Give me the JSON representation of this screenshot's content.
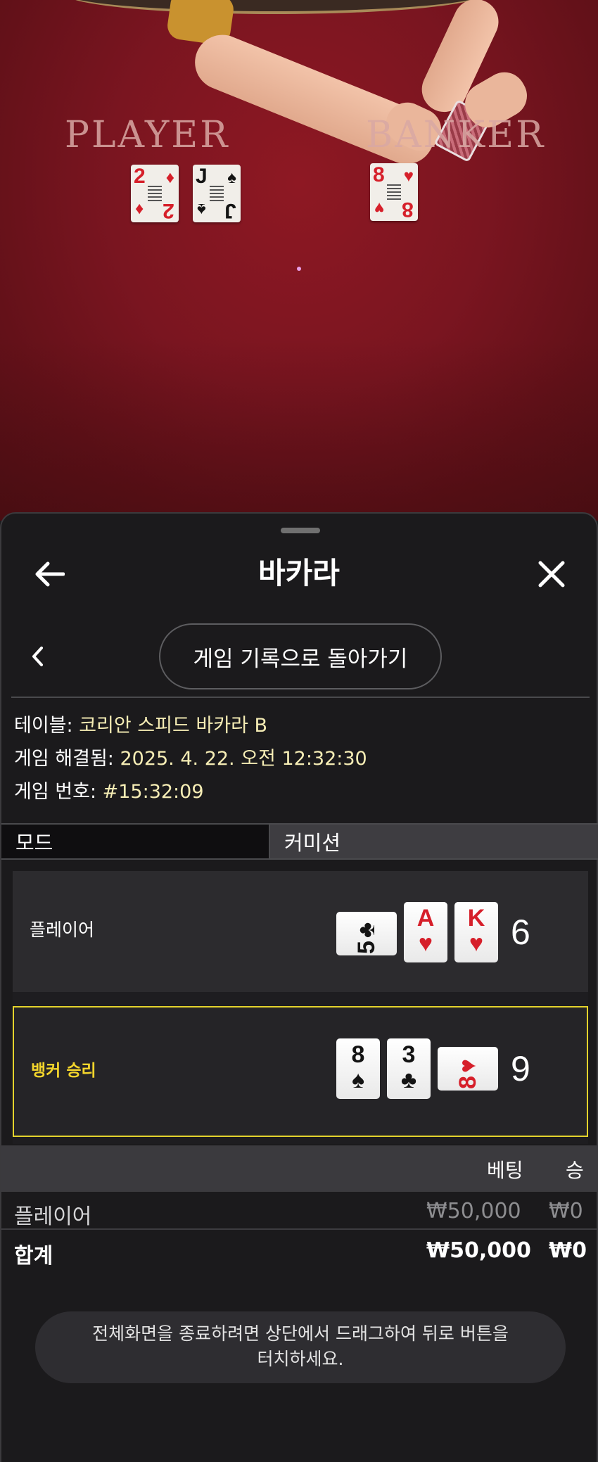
{
  "video": {
    "player_label": "PLAYER",
    "banker_label": "BANKER",
    "player_cards": [
      {
        "rank": "2",
        "suit": "♦",
        "color": "#d61f2a"
      },
      {
        "rank": "J",
        "suit": "♠",
        "color": "#141414"
      }
    ],
    "banker_cards": [
      {
        "rank": "8",
        "suit": "♥",
        "color": "#d61f2a"
      }
    ]
  },
  "header": {
    "title": "바카라",
    "back_icon": "arrow-left-icon",
    "close_icon": "close-icon"
  },
  "nav": {
    "back_chevron_icon": "chevron-left-icon",
    "history_button": "게임 기록으로 돌아가기"
  },
  "game_info": {
    "table_label": "테이블: ",
    "table_value": "코리안 스피드 바카라 B",
    "resolved_label": "게임 해결됨: ",
    "resolved_value": "2025. 4. 22. 오전 12:32:30",
    "number_label": "게임 번호: ",
    "number_value": "#15:32:09"
  },
  "tabs": {
    "mode": "모드",
    "commission": "커미션"
  },
  "results": {
    "player": {
      "label": "플레이어",
      "score": "6",
      "cards": [
        {
          "rank": "5",
          "suit": "♣",
          "color": "#141414",
          "orientation": "sideways"
        },
        {
          "rank": "A",
          "suit": "♥",
          "color": "#d61f2a",
          "orientation": "upright"
        },
        {
          "rank": "K",
          "suit": "♥",
          "color": "#d61f2a",
          "orientation": "upright"
        }
      ]
    },
    "banker": {
      "label": "뱅커 승리",
      "score": "9",
      "highlight_color": "#e4d32c",
      "cards": [
        {
          "rank": "8",
          "suit": "♠",
          "color": "#141414",
          "orientation": "upright"
        },
        {
          "rank": "3",
          "suit": "♣",
          "color": "#141414",
          "orientation": "upright"
        },
        {
          "rank": "8",
          "suit": "♥",
          "color": "#d61f2a",
          "orientation": "sideways"
        }
      ]
    }
  },
  "bets": {
    "col_bet": "베팅",
    "col_win": "승",
    "rows": [
      {
        "name": "플레이어",
        "bet": "₩50,000",
        "win": "₩0"
      }
    ],
    "total": {
      "name": "합계",
      "bet": "₩50,000",
      "win": "₩0"
    }
  },
  "toast": {
    "line1": "전체화면을 종료하려면 상단에서 드래그하여 뒤로 버튼을",
    "line2": "터치하세요."
  }
}
